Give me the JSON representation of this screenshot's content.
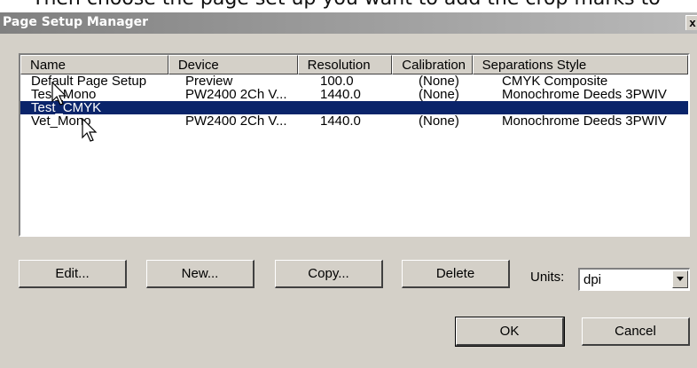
{
  "page_caption": "Then choose the page set up you want to add the crop marks to",
  "window": {
    "title": "Page Setup Manager",
    "close_glyph": "x"
  },
  "columns": [
    "Name",
    "Device",
    "Resolution",
    "Calibration",
    "Separations Style"
  ],
  "rows": [
    {
      "name": "Default Page Setup",
      "device": "Preview",
      "resolution": "100.0",
      "calibration": "(None)",
      "style": "CMYK Composite"
    },
    {
      "name": "Test_Mono",
      "device": "PW2400 2Ch V...",
      "resolution": "1440.0",
      "calibration": "(None)",
      "style": "Monochrome Deeds 3PWIV"
    },
    {
      "name": "Test_CMYK",
      "device": "",
      "resolution": "",
      "calibration": "",
      "style": ""
    },
    {
      "name": "Vet_Mono",
      "device": "PW2400 2Ch V...",
      "resolution": "1440.0",
      "calibration": "(None)",
      "style": "Monochrome Deeds 3PWIV"
    }
  ],
  "selected_row": 2,
  "buttons": {
    "edit": "Edit...",
    "new": "New...",
    "copy": "Copy...",
    "delete": "Delete",
    "ok": "OK",
    "cancel": "Cancel"
  },
  "units": {
    "label": "Units:",
    "value": "dpi"
  },
  "colors": {
    "selection": "#0a246a",
    "dialog_bg": "#d4d0c8",
    "title_gradient_start": "#808080"
  },
  "icons": [
    "close-icon",
    "dropdown-arrow-icon",
    "mouse-cursor-icon"
  ]
}
